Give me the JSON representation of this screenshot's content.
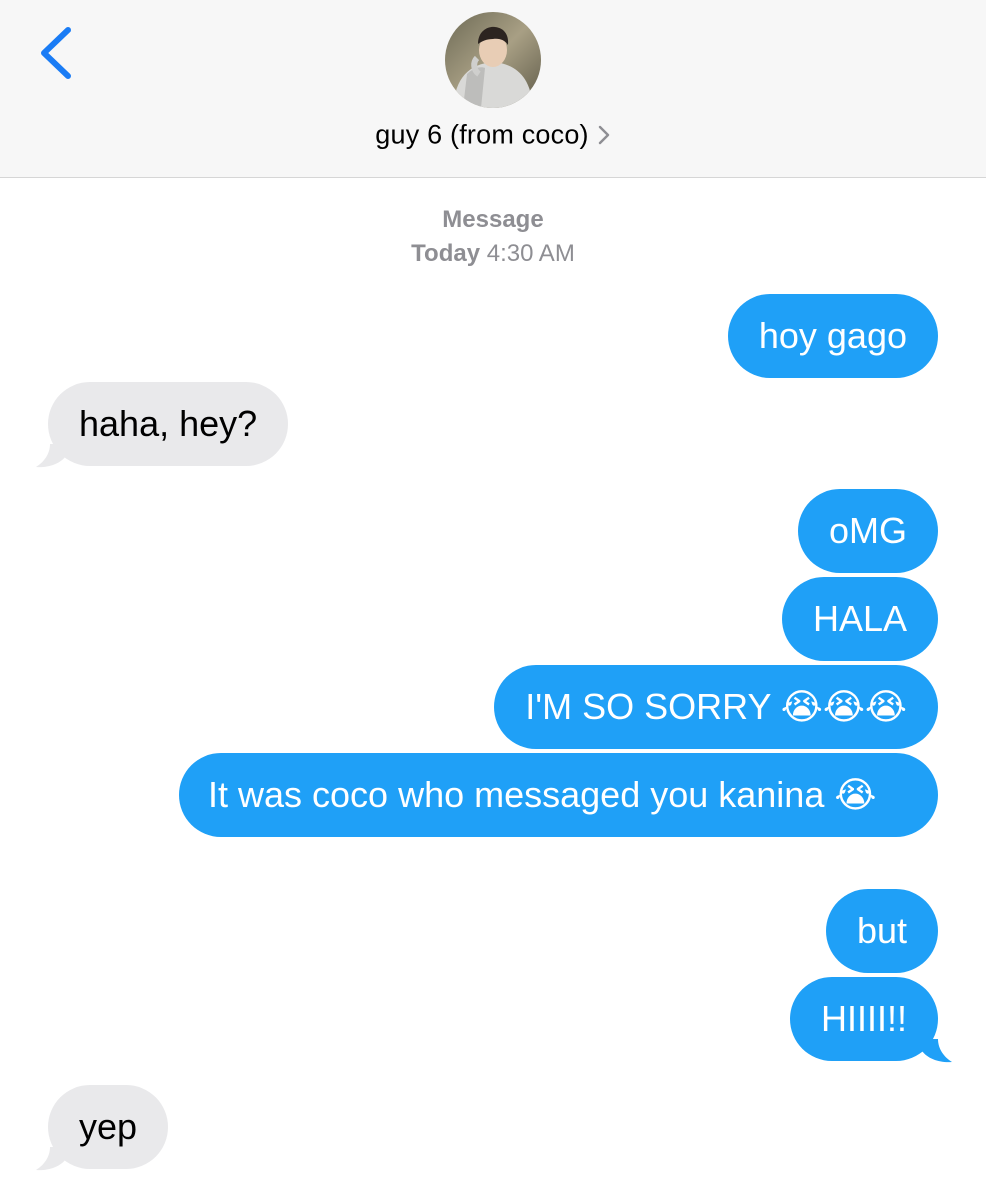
{
  "header": {
    "back_icon": "chevron-left-icon",
    "avatar_icon": "contact-photo",
    "contact_name": "guy 6 (from coco)",
    "chevron_icon": "chevron-right-icon",
    "accent_color": "#1a7cf5"
  },
  "thread": {
    "service": "Message",
    "day": "Today",
    "time": "4:30 AM"
  },
  "messages": [
    {
      "from": "me",
      "text": "hoy gago"
    },
    {
      "from": "them",
      "text": "haha, hey?"
    },
    {
      "from": "me",
      "text": "oMG"
    },
    {
      "from": "me",
      "text": "HALA"
    },
    {
      "from": "me",
      "text": "I'M SO SORRY 😭😭😭"
    },
    {
      "from": "me",
      "text": "It was coco who messaged you kanina 😭"
    },
    {
      "from": "me",
      "text": "but"
    },
    {
      "from": "me",
      "text": "HIIII!!"
    },
    {
      "from": "them",
      "text": "yep"
    }
  ],
  "colors": {
    "outgoing_bubble": "#1fa0f7",
    "incoming_bubble": "#e9e9eb",
    "meta_text": "#8e8e93"
  }
}
